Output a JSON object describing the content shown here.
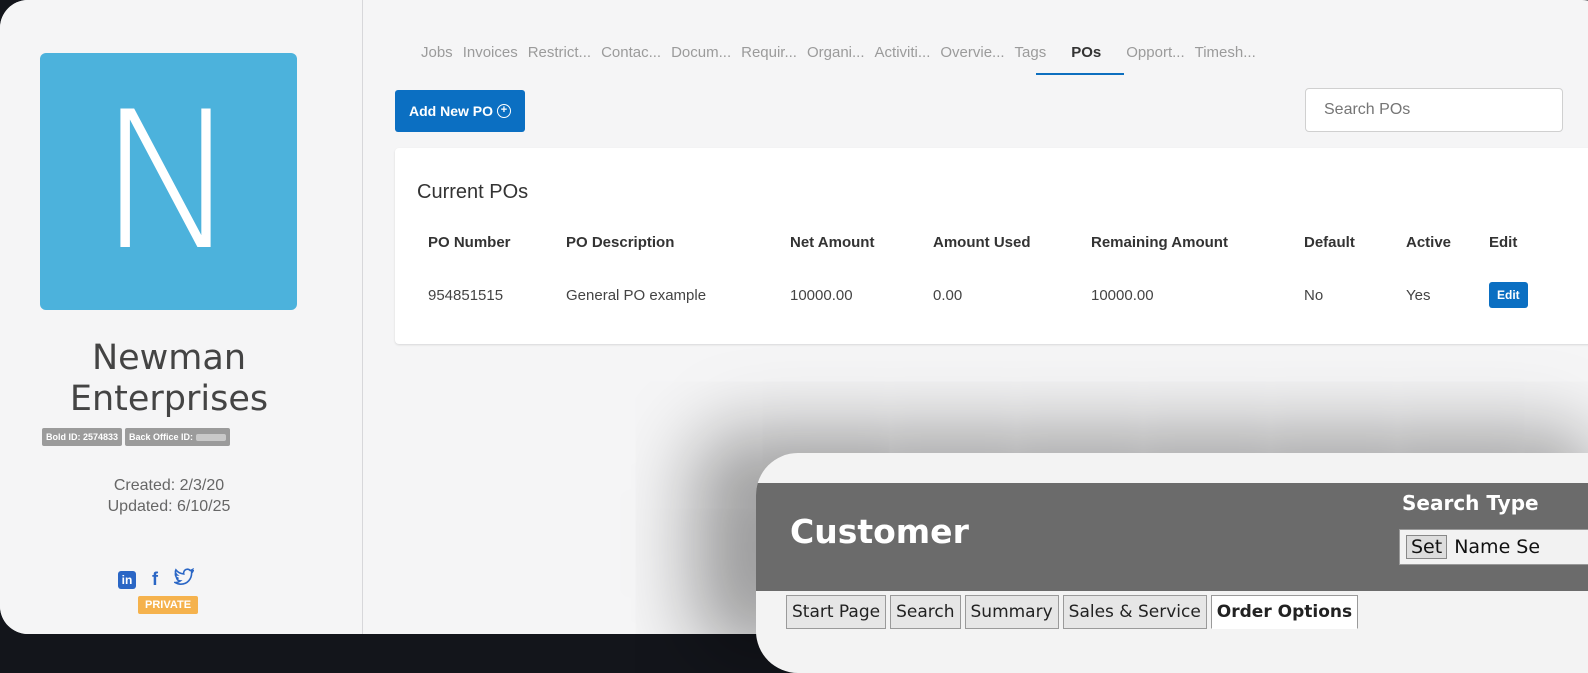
{
  "sidebar": {
    "avatar_letter": "N",
    "company_line1": "Newman",
    "company_line2": "Enterprises",
    "bold_id": "Bold ID: 2574833",
    "back_office_id": "Back Office ID:",
    "created": "Created: 2/3/20",
    "updated": "Updated: 6/10/25",
    "social": [
      "linkedin-icon",
      "facebook-icon",
      "twitter-icon"
    ],
    "privacy_badge": "PRIVATE"
  },
  "tabs": [
    "Jobs",
    "Invoices",
    "Restrict...",
    "Contac...",
    "Docum...",
    "Requir...",
    "Organi...",
    "Activiti...",
    "Overvie...",
    "Tags",
    "POs",
    "Opport...",
    "Timesh..."
  ],
  "active_tab": "POs",
  "toolbar": {
    "add_label": "Add New PO",
    "search_placeholder": "Search POs"
  },
  "table": {
    "title": "Current POs",
    "columns": [
      "PO Number",
      "PO Description",
      "Net Amount",
      "Amount Used",
      "Remaining Amount",
      "Default",
      "Active",
      "Edit"
    ],
    "rows": [
      [
        "954851515",
        "General PO example",
        "10000.00",
        "0.00",
        "10000.00",
        "No",
        "Yes",
        "Edit"
      ]
    ]
  },
  "overlay": {
    "title": "Customer",
    "search_type_label": "Search Type",
    "set_label": "Set",
    "search_type_value": "Name Se",
    "tabs": [
      "Start Page",
      "Search",
      "Summary",
      "Sales & Service",
      "Order Options"
    ],
    "active_tab": "Order Options"
  },
  "colors": {
    "accent": "#0b6fc2",
    "avatar_bg": "#4cb2dc",
    "private_badge": "#f5b24d",
    "overlay_header": "#6b6b6b"
  }
}
